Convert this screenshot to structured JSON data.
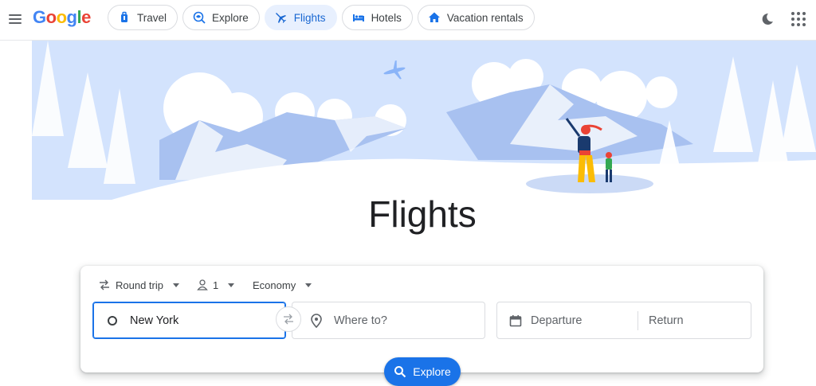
{
  "header": {
    "logo_letters": [
      "G",
      "o",
      "o",
      "g",
      "l",
      "e"
    ],
    "nav": [
      {
        "label": "Travel",
        "icon": "suitcase-icon"
      },
      {
        "label": "Explore",
        "icon": "explore-globe-icon"
      },
      {
        "label": "Flights",
        "icon": "airplane-icon",
        "active": true
      },
      {
        "label": "Hotels",
        "icon": "bed-icon"
      },
      {
        "label": "Vacation rentals",
        "icon": "house-icon"
      }
    ]
  },
  "hero": {
    "title": "Flights"
  },
  "search": {
    "trip_type": "Round trip",
    "passengers": "1",
    "cabin_class": "Economy",
    "origin": "New York",
    "destination_placeholder": "Where to?",
    "departure_placeholder": "Departure",
    "return_placeholder": "Return",
    "explore_button": "Explore"
  },
  "colors": {
    "accent": "#1a73e8",
    "active_chip_bg": "#e8f0fe",
    "illustration_blue": "#a8c1f0",
    "illustration_light": "#d3e3fd"
  }
}
